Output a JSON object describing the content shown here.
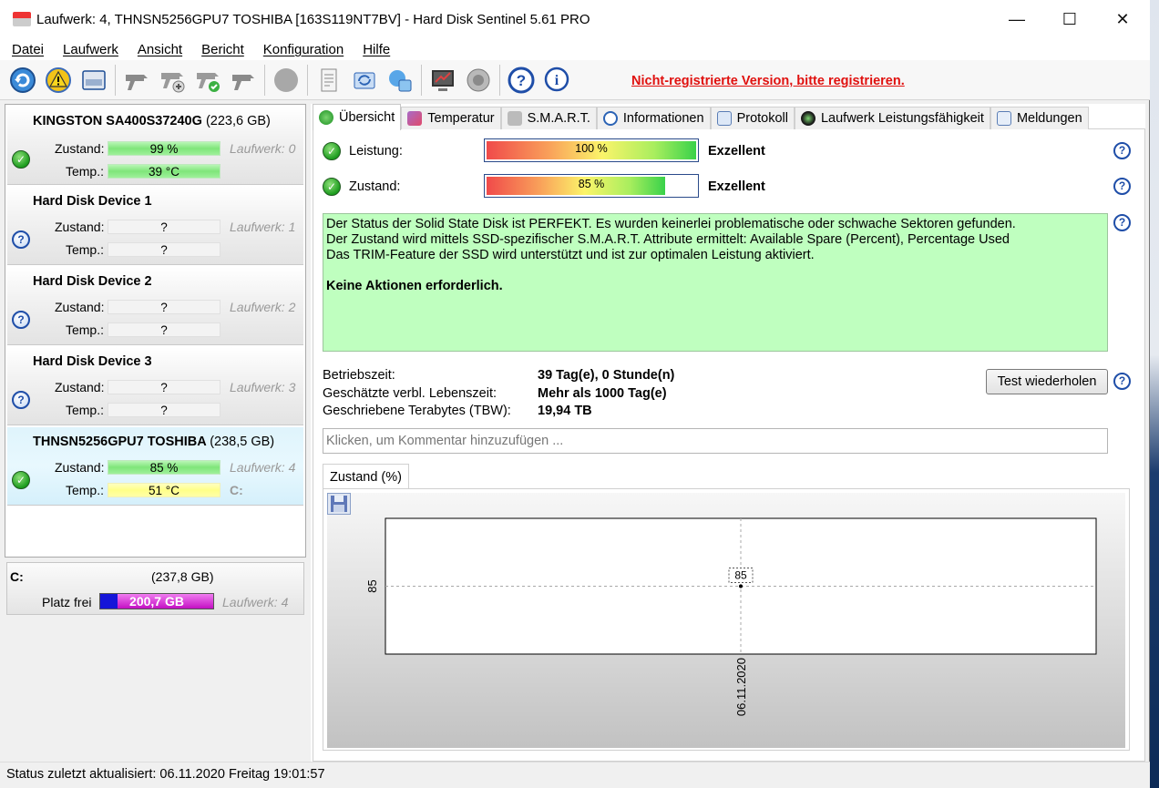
{
  "window": {
    "title": "Laufwerk: 4, THNSN5256GPU7 TOSHIBA [163S119NT7BV]  -  Hard Disk Sentinel 5.61 PRO",
    "minimize": "—",
    "maximize": "☐",
    "close": "✕"
  },
  "menu": [
    "Datei",
    "Laufwerk",
    "Ansicht",
    "Bericht",
    "Konfiguration",
    "Hilfe"
  ],
  "toolbar": {
    "icons": [
      "refresh-icon",
      "warning-icon",
      "disk-info-icon",
      "drill-icon",
      "drill-add-icon",
      "drill-check-icon",
      "drill-tool-icon",
      "stop-icon",
      "report-icon",
      "sync-icon",
      "network-icon",
      "monitor-icon",
      "speaker-icon",
      "help-icon",
      "info-icon"
    ],
    "register_text": "Nicht-registrierte Version, bitte registrieren."
  },
  "disks": [
    {
      "name": "KINGSTON SA400S37240G",
      "size": "(223,6 GB)",
      "zustand_label": "Zustand:",
      "zustand": "99 %",
      "temp_label": "Temp.:",
      "temp": "39 °C",
      "laufwerk": "Laufwerk: 0",
      "drive": "",
      "status": "ok"
    },
    {
      "name": "Hard Disk Device 1",
      "size": "",
      "zustand_label": "Zustand:",
      "zustand": "?",
      "temp_label": "Temp.:",
      "temp": "?",
      "laufwerk": "Laufwerk: 1",
      "drive": "",
      "status": "unknown"
    },
    {
      "name": "Hard Disk Device 2",
      "size": "",
      "zustand_label": "Zustand:",
      "zustand": "?",
      "temp_label": "Temp.:",
      "temp": "?",
      "laufwerk": "Laufwerk: 2",
      "drive": "",
      "status": "unknown"
    },
    {
      "name": "Hard Disk Device 3",
      "size": "",
      "zustand_label": "Zustand:",
      "zustand": "?",
      "temp_label": "Temp.:",
      "temp": "?",
      "laufwerk": "Laufwerk: 3",
      "drive": "",
      "status": "unknown"
    },
    {
      "name": "THNSN5256GPU7 TOSHIBA",
      "size": "(238,5 GB)",
      "zustand_label": "Zustand:",
      "zustand": "85 %",
      "temp_label": "Temp.:",
      "temp": "51 °C",
      "laufwerk": "Laufwerk: 4",
      "drive": "C:",
      "status": "ok"
    }
  ],
  "partition": {
    "letter": "C:",
    "size": "(237,8 GB)",
    "free_label": "Platz frei",
    "free": "200,7 GB",
    "free_fraction": 0.844,
    "laufwerk": "Laufwerk: 4"
  },
  "tabs": [
    "Übersicht",
    "Temperatur",
    "S.M.A.R.T.",
    "Informationen",
    "Protokoll",
    "Laufwerk Leistungsfähigkeit",
    "Meldungen"
  ],
  "overview": {
    "leistung_label": "Leistung:",
    "leistung_value": "100 %",
    "leistung_fraction": 1.0,
    "leistung_rating": "Exzellent",
    "zustand_label": "Zustand:",
    "zustand_value": "85 %",
    "zustand_fraction": 0.85,
    "zustand_rating": "Exzellent",
    "status_lines": [
      "Der Status der Solid State Disk ist PERFEKT. Es wurden keinerlei problematische oder schwache Sektoren gefunden.",
      "Der Zustand wird mittels SSD-spezifischer S.M.A.R.T. Attribute ermittelt:  Available Spare (Percent), Percentage Used",
      "Das TRIM-Feature der SSD wird unterstützt und ist zur optimalen Leistung aktiviert."
    ],
    "status_action": "Keine Aktionen erforderlich.",
    "betriebszeit_label": "Betriebszeit:",
    "betriebszeit": "39 Tag(e), 0 Stunde(n)",
    "lebenszeit_label": "Geschätzte verbl. Lebenszeit:",
    "lebenszeit": "Mehr als 1000 Tag(e)",
    "tbw_label": "Geschriebene Terabytes (TBW):",
    "tbw": "19,94 TB",
    "retest_button": "Test wiederholen",
    "comment_placeholder": "Klicken, um Kommentar hinzuzufügen ..."
  },
  "chart_tab": "Zustand (%)",
  "chart_data": {
    "type": "line",
    "x": [
      "06.11.2020"
    ],
    "series": [
      {
        "values": [
          85
        ]
      }
    ],
    "ytick_labels": [
      "85"
    ],
    "xtick_labels": [
      "06.11.2020"
    ],
    "data_labels": [
      "85"
    ]
  },
  "statusbar": "Status zuletzt aktualisiert: 06.11.2020 Freitag 19:01:57",
  "colors": {
    "accent_red": "#e0110f",
    "status_green": "#bfffbf",
    "selected_blue": "#dff4fc"
  }
}
